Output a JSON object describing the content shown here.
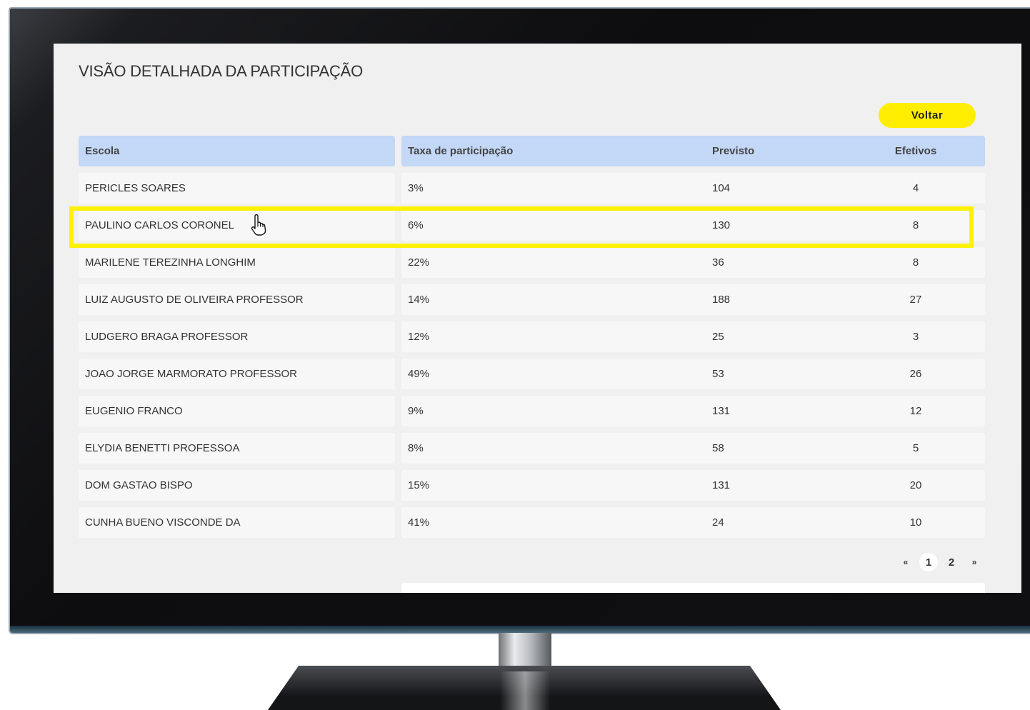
{
  "page": {
    "title": "VISÃO DETALHADA DA PARTICIPAÇÃO",
    "back_label": "Voltar"
  },
  "table": {
    "headers": {
      "school": "Escola",
      "rate": "Taxa de participação",
      "expected": "Previsto",
      "effective": "Efetivos"
    },
    "rows": [
      {
        "school": "PERICLES SOARES",
        "rate": "3%",
        "expected": "104",
        "effective": "4"
      },
      {
        "school": "PAULINO CARLOS CORONEL",
        "rate": "6%",
        "expected": "130",
        "effective": "8"
      },
      {
        "school": "MARILENE TEREZINHA LONGHIM",
        "rate": "22%",
        "expected": "36",
        "effective": "8"
      },
      {
        "school": "LUIZ AUGUSTO DE OLIVEIRA PROFESSOR",
        "rate": "14%",
        "expected": "188",
        "effective": "27"
      },
      {
        "school": "LUDGERO BRAGA PROFESSOR",
        "rate": "12%",
        "expected": "25",
        "effective": "3"
      },
      {
        "school": "JOAO JORGE MARMORATO PROFESSOR",
        "rate": "49%",
        "expected": "53",
        "effective": "26"
      },
      {
        "school": "EUGENIO FRANCO",
        "rate": "9%",
        "expected": "131",
        "effective": "12"
      },
      {
        "school": "ELYDIA BENETTI PROFESSOA",
        "rate": "8%",
        "expected": "58",
        "effective": "5"
      },
      {
        "school": "DOM GASTAO BISPO",
        "rate": "15%",
        "expected": "131",
        "effective": "20"
      },
      {
        "school": "CUNHA BUENO VISCONDE DA",
        "rate": "41%",
        "expected": "24",
        "effective": "10"
      }
    ]
  },
  "pagination": {
    "prev": "«",
    "pages": [
      "1",
      "2"
    ],
    "next": "»"
  },
  "colors": {
    "accent": "#ffee00",
    "header_bg": "#c3d7f6",
    "highlight": "#fff200"
  },
  "icons": {
    "cursor": "hand-pointer-icon"
  }
}
